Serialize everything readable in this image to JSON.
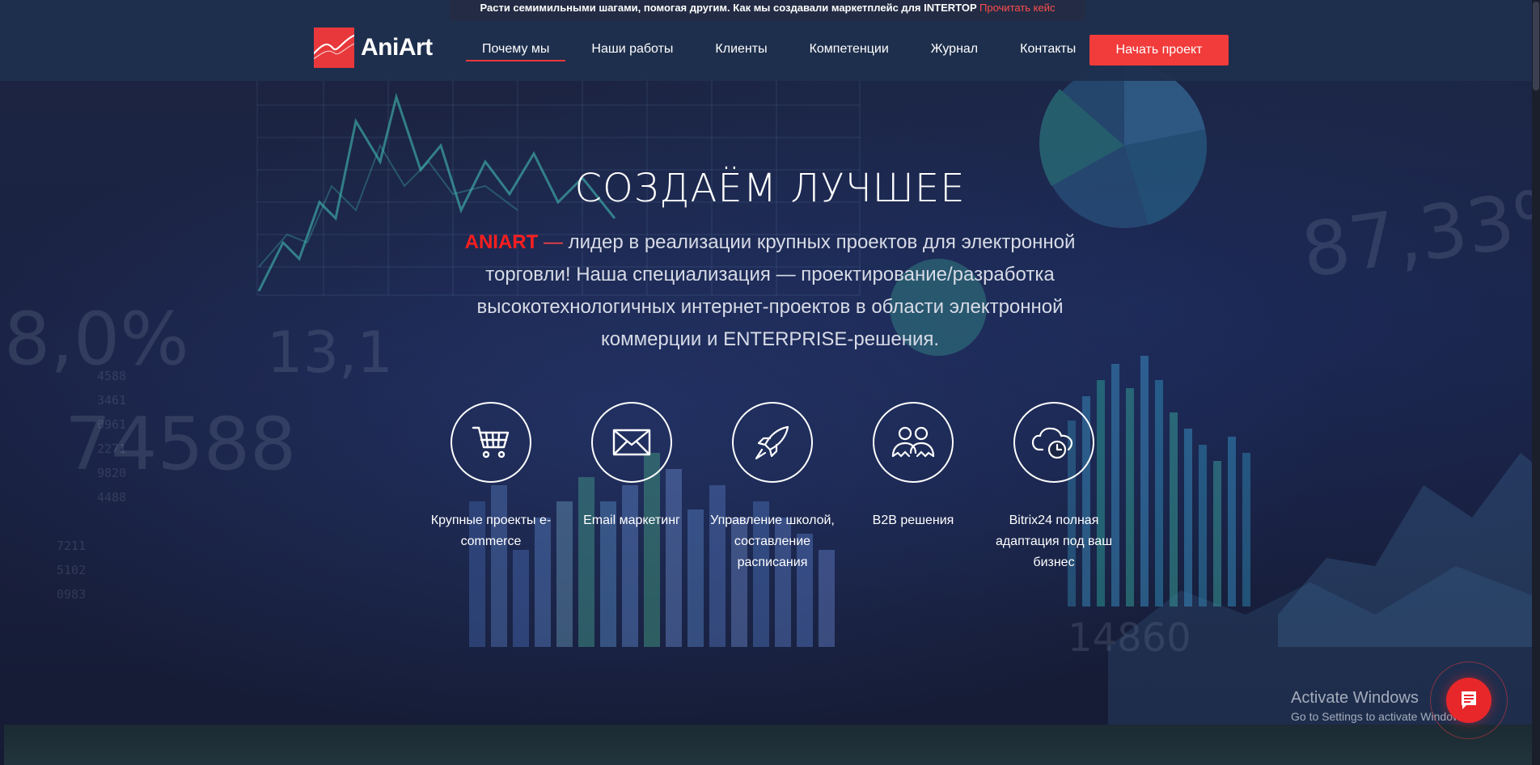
{
  "announcement": {
    "text": "Расти семимильными шагами, помогая другим. Как мы создавали маркетплейс для INTERTOP",
    "link_label": "Прочитать кейс"
  },
  "header": {
    "logo_text": "AniArt",
    "nav": [
      {
        "label": "Почему мы",
        "active": true
      },
      {
        "label": "Наши работы",
        "active": false
      },
      {
        "label": "Клиенты",
        "active": false
      },
      {
        "label": "Компетенции",
        "active": false
      },
      {
        "label": "Журнал",
        "active": false
      },
      {
        "label": "Контакты",
        "active": false
      }
    ],
    "cta_label": "Начать проект"
  },
  "hero": {
    "title": "СОЗДАЁМ  ЛУЧШЕЕ",
    "brand": "ANIART",
    "dash": " — ",
    "description": "лидер в реализации крупных проектов для электронной торговли! Наша специализация — проектирование/разработка высокотехнологичных интернет-проектов в области электронной коммерции и ENTERPRISE-решения."
  },
  "features": [
    {
      "icon": "shopping-cart-icon",
      "label": "Крупные проекты e-commerce"
    },
    {
      "icon": "envelope-icon",
      "label": "Email маркетинг"
    },
    {
      "icon": "rocket-icon",
      "label": "Управление школой, составление расписания"
    },
    {
      "icon": "users-group-icon",
      "label": "B2B решения"
    },
    {
      "icon": "cloud-clock-icon",
      "label": "Bitrix24 полная адаптация под ваш бизнес"
    }
  ],
  "windows_watermark": {
    "line1": "Activate Windows",
    "line2": "Go to Settings to activate Windows."
  },
  "colors": {
    "accent": "#e8383b",
    "header_bg": "#1e304e",
    "brand_red": "#ff1e1e"
  }
}
